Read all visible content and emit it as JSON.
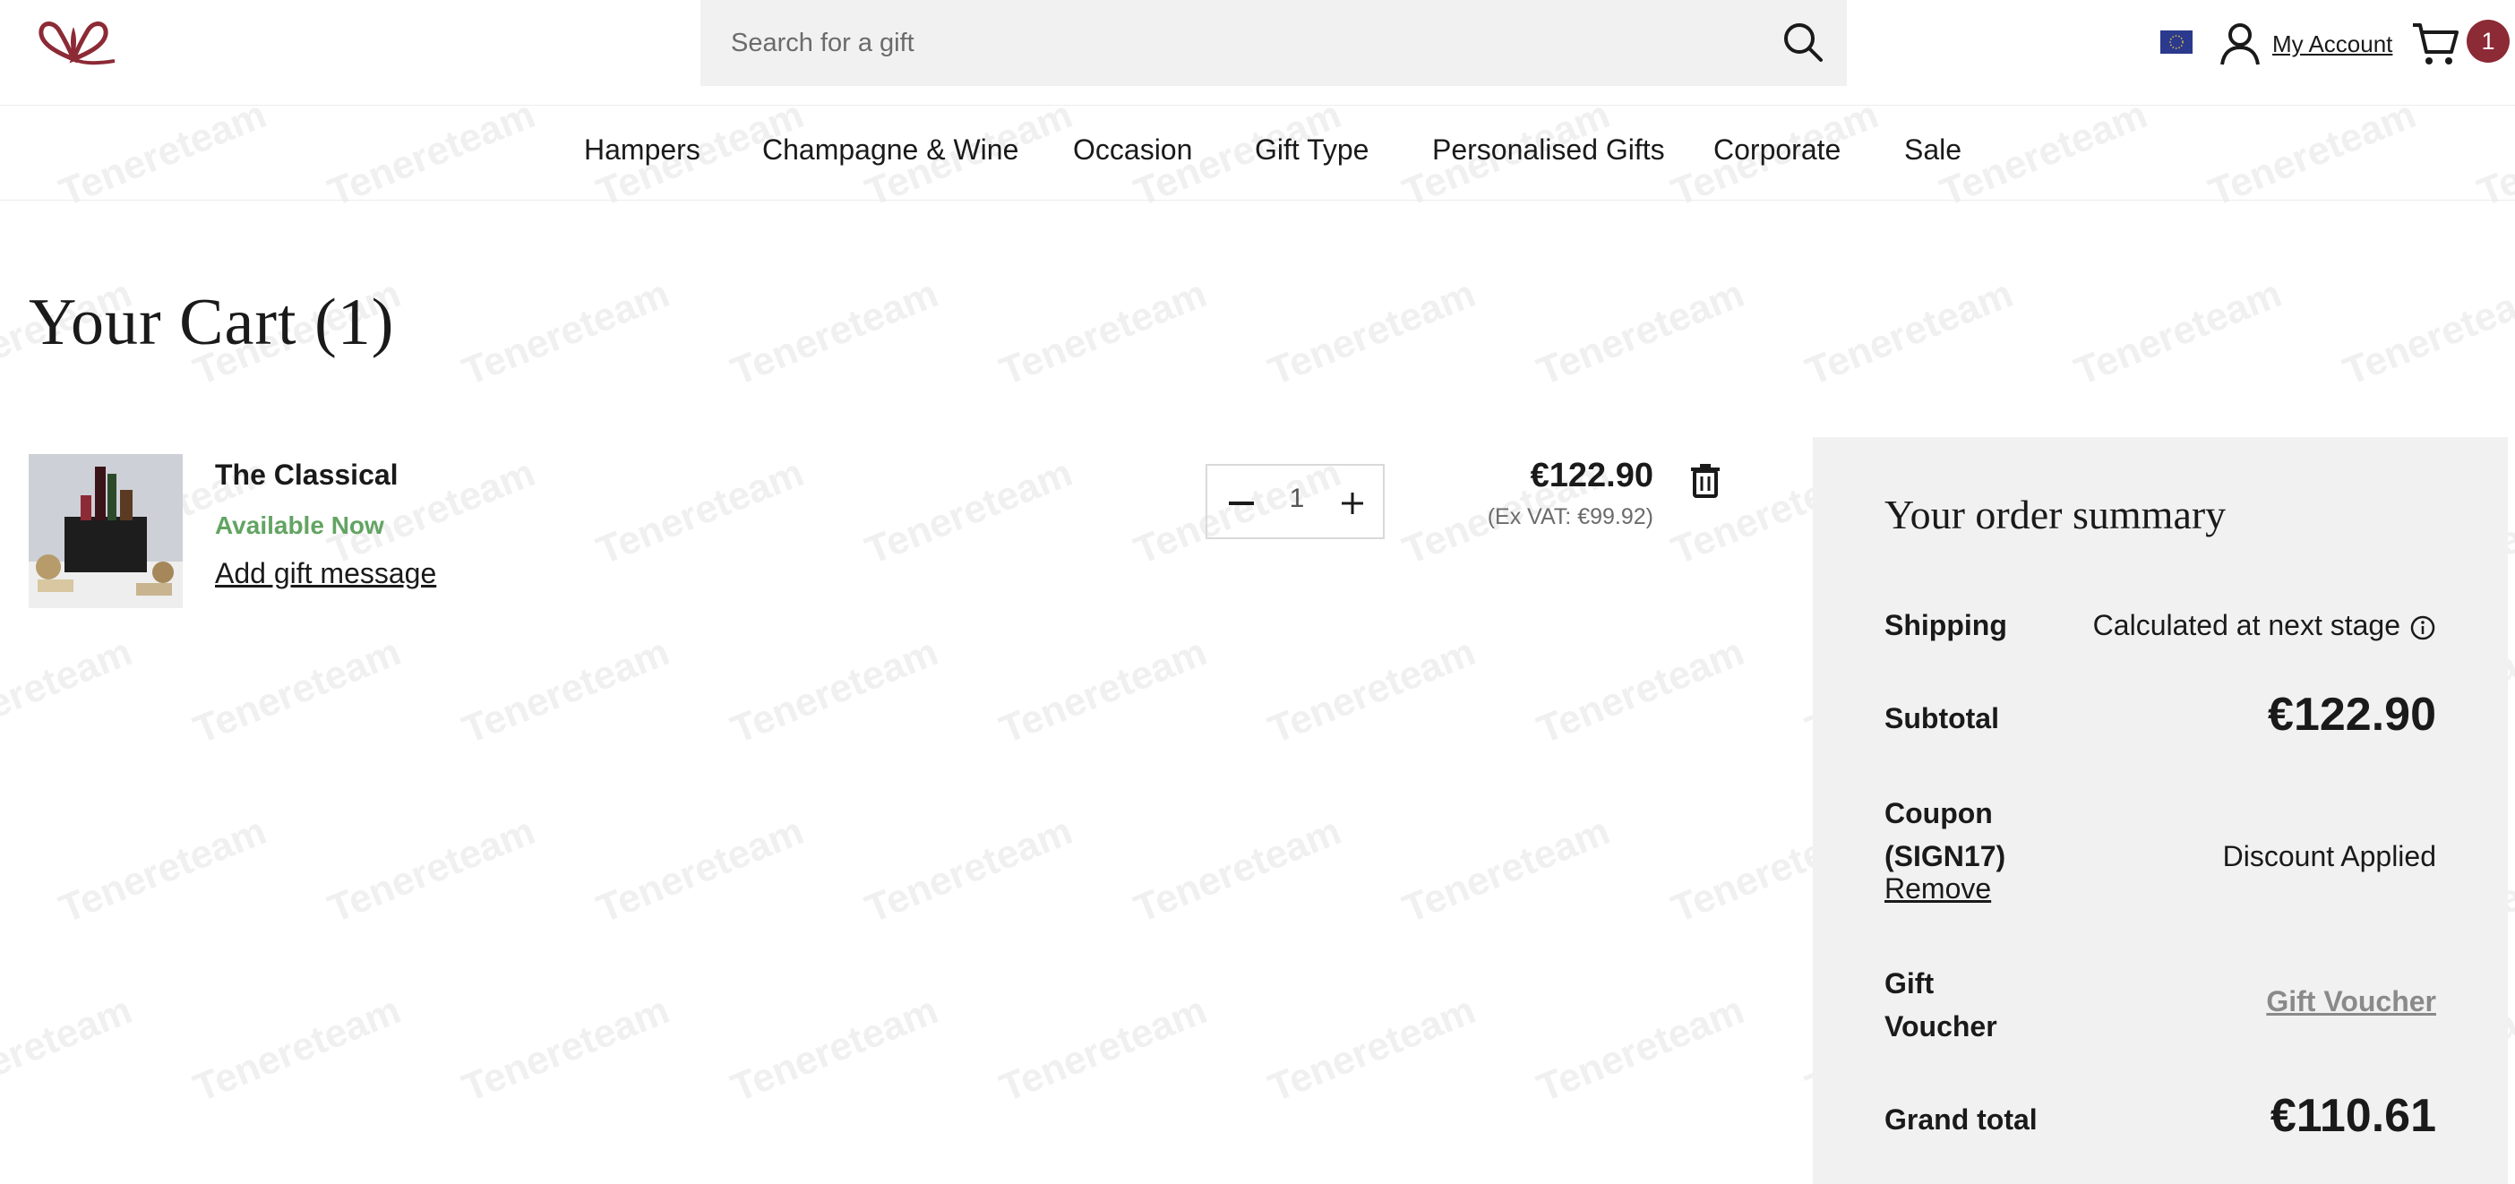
{
  "header": {
    "search_placeholder": "Search for a gift",
    "account_label": "My Account",
    "cart_count": "1"
  },
  "nav": {
    "items": [
      "Hampers",
      "Champagne & Wine",
      "Occasion",
      "Gift Type",
      "Personalised Gifts",
      "Corporate",
      "Sale"
    ]
  },
  "watermark_text": "Tenereteam",
  "cart": {
    "title": "Your Cart (1)",
    "item": {
      "name": "The Classical",
      "availability": "Available Now",
      "gift_message_link": "Add gift message",
      "quantity": "1",
      "price": "€122.90",
      "ex_vat": "(Ex VAT: €99.92)"
    }
  },
  "summary": {
    "title": "Your order summary",
    "shipping_label": "Shipping",
    "shipping_value": "Calculated at next stage",
    "subtotal_label": "Subtotal",
    "subtotal_value": "€122.90",
    "coupon_label_line1": "Coupon",
    "coupon_label_line2": "(SIGN17)",
    "coupon_value": "Discount Applied",
    "remove_link": "Remove",
    "voucher_label_line1": "Gift",
    "voucher_label_line2": "Voucher",
    "voucher_link": "Gift Voucher",
    "grand_total_label": "Grand total",
    "grand_total_value": "€110.61"
  },
  "colors": {
    "brand": "#8c2a35",
    "available": "#62a462",
    "summary_bg": "#f1f1f1",
    "search_bg": "#f1f1f1"
  }
}
